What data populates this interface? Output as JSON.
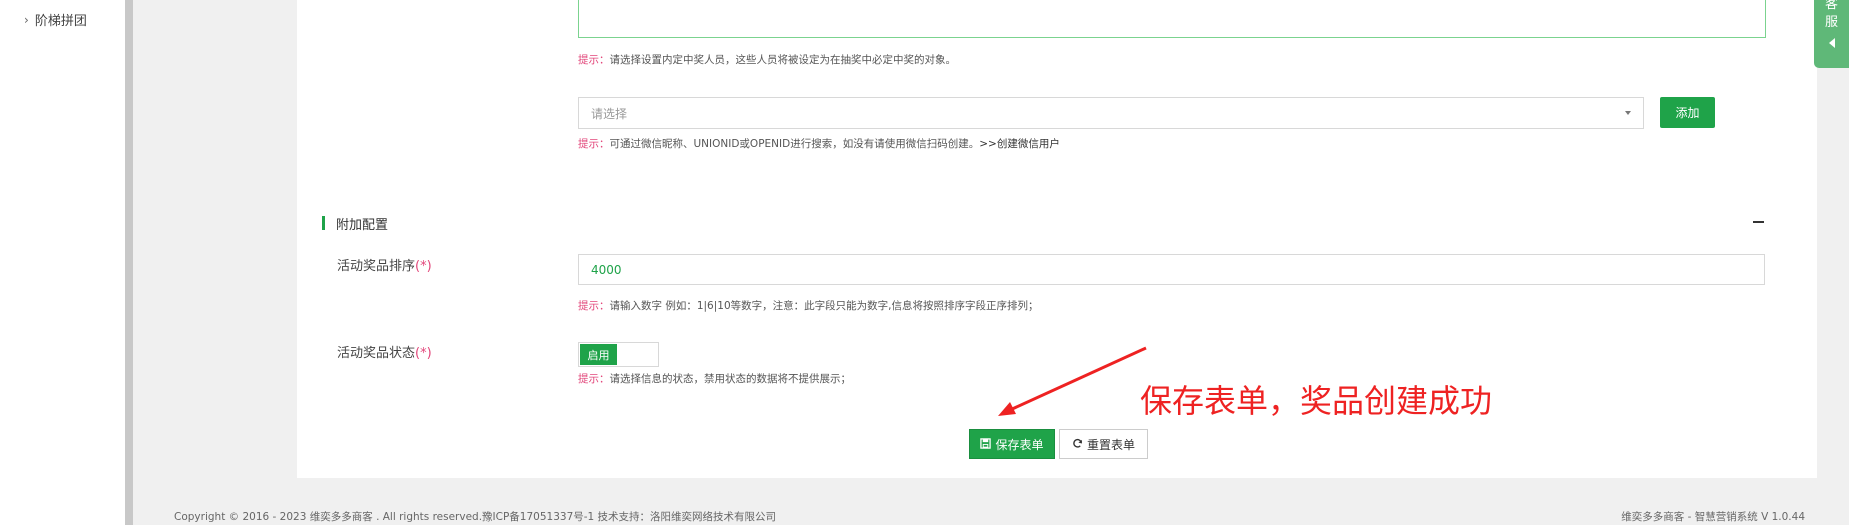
{
  "sidebar": {
    "items": [
      {
        "label": "阶梯拼团"
      }
    ]
  },
  "form": {
    "winners_hint": {
      "label": "提示：",
      "text": "请选择设置内定中奖人员，这些人员将被设定为在抽奖中必定中奖的对象。"
    },
    "user_select": {
      "placeholder": "请选择"
    },
    "add_button": "添加",
    "user_hint": {
      "label": "提示：",
      "text": "可通过微信昵称、UNIONID或OPENID进行搜索，如没有请使用微信扫码创建。",
      "link": ">>创建微信用户"
    },
    "extra_section": {
      "title": "附加配置"
    },
    "sort_field": {
      "label": "活动奖品排序",
      "required": "(*)",
      "value": "4000",
      "hint_label": "提示：",
      "hint_text": "请输入数字 例如：1|6|10等数字，注意：此字段只能为数字,信息将按照排序字段正序排列；"
    },
    "status_field": {
      "label": "活动奖品状态",
      "required": "(*)",
      "toggle_on_label": "启用",
      "toggle_state": "on",
      "hint_label": "提示：",
      "hint_text": "请选择信息的状态，禁用状态的数据将不提供展示；"
    },
    "save_button": "保存表单",
    "reset_button": "重置表单"
  },
  "annotation": {
    "text": "保存表单，奖品创建成功",
    "color": "#ee2222"
  },
  "footer": {
    "left": "Copyright © 2016 - 2023 维奕多多商客 . All rights reserved.豫ICP备17051337号-1 技术支持：洛阳维奕网络技术有限公司",
    "right": "维奕多多商客 - 智慧营销系统 V 1.0.44"
  },
  "service_tab": {
    "label_line1": "客",
    "label_line2": "服"
  },
  "colors": {
    "accent": "#1fa349",
    "hint_label": "#e2467a",
    "service_tab": "#5fb878"
  }
}
